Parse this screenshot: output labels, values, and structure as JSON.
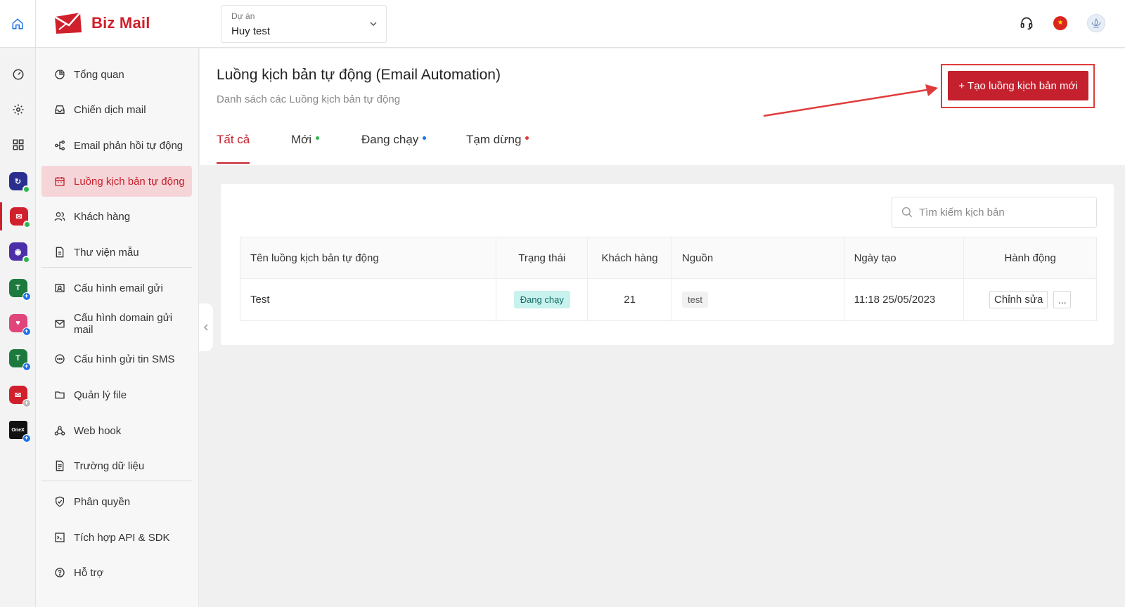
{
  "brand": {
    "biz": "Biz",
    "mail": "Mail"
  },
  "project": {
    "label": "Dự án",
    "value": "Huy test"
  },
  "sidebar": {
    "items": [
      {
        "label": "Tổng quan",
        "icon": "pie-chart-icon"
      },
      {
        "label": "Chiến dịch mail",
        "icon": "inbox-icon"
      },
      {
        "label": "Email phản hồi tự động",
        "icon": "share-nodes-icon"
      },
      {
        "label": "Luồng kịch bản tự động",
        "icon": "calendar-icon",
        "active": true
      },
      {
        "label": "Khách hàng",
        "icon": "users-icon"
      },
      {
        "label": "Thư viện mẫu",
        "icon": "document-icon"
      },
      {
        "label": "Cấu hình email gửi",
        "icon": "contact-card-icon"
      },
      {
        "label": "Cấu hình domain gửi mail",
        "icon": "mail-icon"
      },
      {
        "label": "Cấu hình gửi tin SMS",
        "icon": "chat-icon"
      },
      {
        "label": "Quản lý file",
        "icon": "folder-icon"
      },
      {
        "label": "Web hook",
        "icon": "webhook-icon"
      },
      {
        "label": "Trường dữ liệu",
        "icon": "file-text-icon"
      },
      {
        "label": "Phân quyền",
        "icon": "shield-check-icon"
      },
      {
        "label": "Tích hợp API & SDK",
        "icon": "terminal-icon"
      },
      {
        "label": "Hỗ trợ",
        "icon": "help-circle-icon"
      }
    ]
  },
  "main": {
    "title": "Luồng kịch bản tự động (Email Automation)",
    "subtitle": "Danh sách các Luồng kịch bản tự động",
    "create_button": "+ Tạo luồng kịch bản mới",
    "tabs": [
      {
        "label": "Tất cả",
        "active": true
      },
      {
        "label": "Mới",
        "dot_color": "#2db84d"
      },
      {
        "label": "Đang chạy",
        "dot_color": "#1e73e8"
      },
      {
        "label": "Tạm dừng",
        "dot_color": "#e03b3b"
      }
    ],
    "search_placeholder": "Tìm kiếm kịch bản",
    "table": {
      "headers": [
        "Tên luồng kịch bản tự động",
        "Trạng thái",
        "Khách hàng",
        "Nguồn",
        "Ngày tạo",
        "Hành động"
      ],
      "rows": [
        {
          "name": "Test",
          "status": "Đang chạy",
          "customers": "21",
          "source": "test",
          "created": "11:18 25/05/2023",
          "edit": "Chỉnh sửa",
          "more": "..."
        }
      ]
    }
  },
  "onex_label": "OneX",
  "colors": {
    "brand_red": "#c4202d",
    "active_bg": "#f5d5d8",
    "running_badge": "#c8f2ee"
  }
}
